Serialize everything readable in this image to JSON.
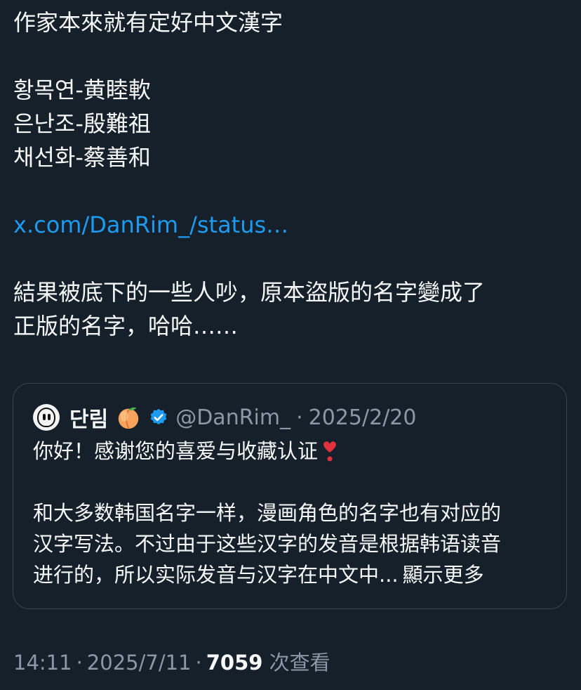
{
  "tweet": {
    "lines": [
      "作家本來就有定好中文漢字",
      "황목연-黄睦軟",
      "은난조-殷難祖",
      "채선화-蔡善和",
      "x.com/DanRim_/status…",
      "結果被底下的一些人吵，原本盜版的名字變成了",
      "正版的名字，哈哈……"
    ]
  },
  "quote": {
    "name": "단림",
    "handle": "@DanRim_",
    "dot": "·",
    "date": "2025/2/20",
    "lines": [
      "你好！感谢您的喜爱与收藏认证",
      "和大多数韩国名字一样，漫画角色的名字也有对应的",
      "汉字写法。不过由于这些汉字的发音是根据韩语读音",
      "进行的，所以实际发音与汉字在中文中..."
    ],
    "show_more": "顯示更多",
    "icons": [
      "avatar",
      "peach-emoji-icon",
      "verified-badge-icon",
      "heart-exclamation-icon"
    ],
    "colors": {
      "verified": "#1d9bf0",
      "heart": "#e0313c",
      "peach": "#f7a35c"
    }
  },
  "meta": {
    "time": "14:11",
    "sep": "·",
    "date": "2025/7/11",
    "views_count": "7059",
    "views_label": "次查看"
  },
  "colors": {
    "background": "#15202b",
    "text": "#f7f9f9",
    "secondary": "#8b98a5",
    "link": "#1d9bf0",
    "border": "#38444d"
  }
}
